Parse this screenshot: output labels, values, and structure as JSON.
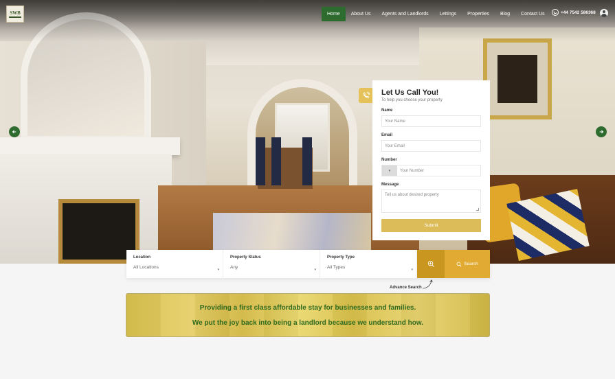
{
  "brand": {
    "logo_text": "SWB"
  },
  "nav": {
    "items": [
      {
        "label": "Home",
        "active": true
      },
      {
        "label": "About Us",
        "active": false
      },
      {
        "label": "Agents and Landlords",
        "active": false
      },
      {
        "label": "Lettings",
        "active": false
      },
      {
        "label": "Properties",
        "active": false
      },
      {
        "label": "Blog",
        "active": false
      },
      {
        "label": "Contact Us",
        "active": false
      }
    ],
    "phone": "+44 7542 586368"
  },
  "callback_form": {
    "title": "Let Us Call You!",
    "subtitle": "To help you choose your property",
    "name_label": "Name",
    "name_placeholder": "Your Name",
    "email_label": "Email",
    "email_placeholder": "Your Email",
    "number_label": "Number",
    "number_placeholder": "Your Number",
    "message_label": "Message",
    "message_placeholder": "Tell us about desired property",
    "submit_label": "Submit"
  },
  "search": {
    "location_label": "Location",
    "location_value": "All Locations",
    "status_label": "Property Status",
    "status_value": "Any",
    "type_label": "Property Type",
    "type_value": "All Types",
    "search_label": "Search",
    "advance_label": "Advance Search"
  },
  "banner": {
    "line1": "Providing a first class affordable stay for businesses and families.",
    "line2": "We put the joy back into being a landlord because we understand how."
  },
  "colors": {
    "primary_green": "#2e6b2f",
    "gold": "#e1ab33",
    "submit_gold": "#dcbc58"
  }
}
